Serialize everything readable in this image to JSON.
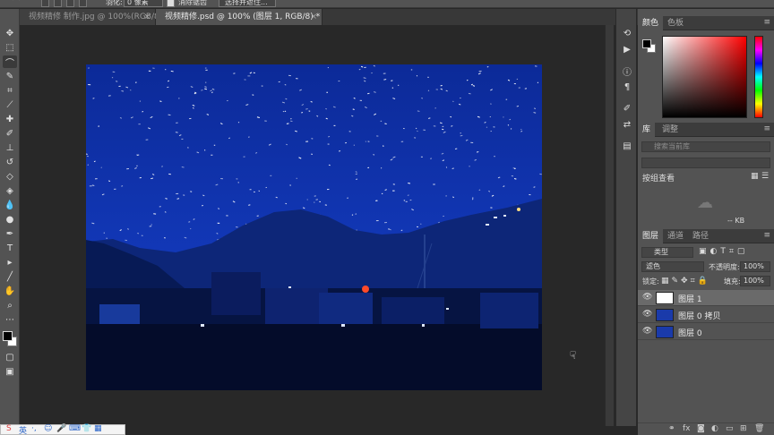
{
  "options_bar": {
    "feather_label": "羽化:",
    "feather_value": "0 像素",
    "antialias_label": "消除锯齿",
    "select_mask_label": "选择并遮住..."
  },
  "tabs": [
    {
      "label": "视频精修 制作.jpg @ 100%(RGB/8)",
      "active": false
    },
    {
      "label": "视频精修.psd @ 100% (图层 1, RGB/8) *",
      "active": true
    }
  ],
  "tools": [
    "move-icon",
    "marquee-icon",
    "lasso-icon",
    "quick-select-icon",
    "crop-icon",
    "eyedropper-icon",
    "healing-icon",
    "brush-icon",
    "stamp-icon",
    "history-brush-icon",
    "eraser-icon",
    "paint-bucket-icon",
    "blur-icon",
    "dodge-icon",
    "pen-icon",
    "type-icon",
    "path-select-icon",
    "shape-icon",
    "hand-icon",
    "zoom-icon",
    "more-icon"
  ],
  "color_panel": {
    "tabs": [
      "颜色",
      "色板"
    ],
    "foreground": "#000000",
    "background": "#ffffff"
  },
  "library_panel": {
    "tabs": [
      "库",
      "调整"
    ],
    "search_placeholder": "搜索当前库",
    "view_label": "按组查看",
    "size_label": "-- KB"
  },
  "layers_panel": {
    "tabs": [
      "图层",
      "通道",
      "路径"
    ],
    "kind_label": "类型",
    "blend_mode": "滤色",
    "opacity_label": "不透明度:",
    "opacity_value": "100%",
    "lock_label": "锁定:",
    "fill_label": "填充:",
    "fill_value": "100%",
    "layers": [
      {
        "name": "图层 1",
        "selected": true
      },
      {
        "name": "图层 0 拷贝",
        "selected": false
      },
      {
        "name": "图层 0",
        "selected": false
      }
    ]
  },
  "ime": {
    "lang": "英"
  },
  "colors": {
    "ui_dark": "#282828",
    "ui_mid": "#535353",
    "night_sky": "#0f2fa0"
  }
}
